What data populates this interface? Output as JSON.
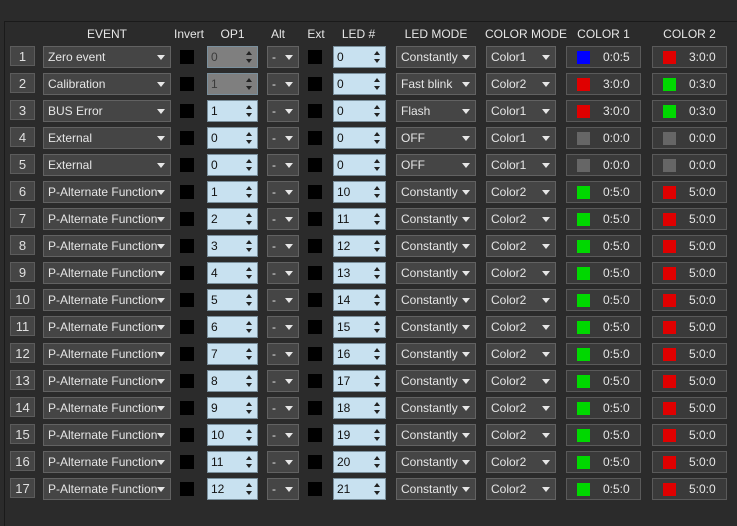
{
  "headers": {
    "event": "EVENT",
    "invert": "Invert",
    "op1": "OP1",
    "alt": "Alt",
    "ext": "Ext",
    "led_num": "LED #",
    "led_mode": "LED MODE",
    "color_mode": "COLOR MODE",
    "color1": "COLOR 1",
    "color2": "COLOR 2"
  },
  "rows": [
    {
      "num": "1",
      "event": "Zero event",
      "op1": "0",
      "op1_disabled": true,
      "alt": "-",
      "led": "0",
      "led_mode": "Constantly",
      "color_mode": "Color1",
      "color1": {
        "color": "#0000ff",
        "value": "0:0:5"
      },
      "color2": {
        "color": "#e00000",
        "value": "3:0:0"
      }
    },
    {
      "num": "2",
      "event": "Calibration",
      "op1": "1",
      "op1_disabled": true,
      "alt": "-",
      "led": "0",
      "led_mode": "Fast blink",
      "color_mode": "Color2",
      "color1": {
        "color": "#e00000",
        "value": "3:0:0"
      },
      "color2": {
        "color": "#00d800",
        "value": "0:3:0"
      }
    },
    {
      "num": "3",
      "event": "BUS Error",
      "op1": "1",
      "op1_disabled": false,
      "alt": "-",
      "led": "0",
      "led_mode": "Flash",
      "color_mode": "Color1",
      "color1": {
        "color": "#e00000",
        "value": "3:0:0"
      },
      "color2": {
        "color": "#00d800",
        "value": "0:3:0"
      }
    },
    {
      "num": "4",
      "event": "External",
      "op1": "0",
      "op1_disabled": false,
      "alt": "-",
      "led": "0",
      "led_mode": "OFF",
      "color_mode": "Color1",
      "color1": {
        "color": "#666666",
        "value": "0:0:0"
      },
      "color2": {
        "color": "#666666",
        "value": "0:0:0"
      }
    },
    {
      "num": "5",
      "event": "External",
      "op1": "0",
      "op1_disabled": false,
      "alt": "-",
      "led": "0",
      "led_mode": "OFF",
      "color_mode": "Color1",
      "color1": {
        "color": "#666666",
        "value": "0:0:0"
      },
      "color2": {
        "color": "#666666",
        "value": "0:0:0"
      }
    },
    {
      "num": "6",
      "event": "P-Alternate Function",
      "op1": "1",
      "op1_disabled": false,
      "alt": "-",
      "led": "10",
      "led_mode": "Constantly",
      "color_mode": "Color2",
      "color1": {
        "color": "#00d800",
        "value": "0:5:0"
      },
      "color2": {
        "color": "#e00000",
        "value": "5:0:0"
      }
    },
    {
      "num": "7",
      "event": "P-Alternate Function",
      "op1": "2",
      "op1_disabled": false,
      "alt": "-",
      "led": "11",
      "led_mode": "Constantly",
      "color_mode": "Color2",
      "color1": {
        "color": "#00d800",
        "value": "0:5:0"
      },
      "color2": {
        "color": "#e00000",
        "value": "5:0:0"
      }
    },
    {
      "num": "8",
      "event": "P-Alternate Function",
      "op1": "3",
      "op1_disabled": false,
      "alt": "-",
      "led": "12",
      "led_mode": "Constantly",
      "color_mode": "Color2",
      "color1": {
        "color": "#00d800",
        "value": "0:5:0"
      },
      "color2": {
        "color": "#e00000",
        "value": "5:0:0"
      }
    },
    {
      "num": "9",
      "event": "P-Alternate Function",
      "op1": "4",
      "op1_disabled": false,
      "alt": "-",
      "led": "13",
      "led_mode": "Constantly",
      "color_mode": "Color2",
      "color1": {
        "color": "#00d800",
        "value": "0:5:0"
      },
      "color2": {
        "color": "#e00000",
        "value": "5:0:0"
      }
    },
    {
      "num": "10",
      "event": "P-Alternate Function",
      "op1": "5",
      "op1_disabled": false,
      "alt": "-",
      "led": "14",
      "led_mode": "Constantly",
      "color_mode": "Color2",
      "color1": {
        "color": "#00d800",
        "value": "0:5:0"
      },
      "color2": {
        "color": "#e00000",
        "value": "5:0:0"
      }
    },
    {
      "num": "11",
      "event": "P-Alternate Function",
      "op1": "6",
      "op1_disabled": false,
      "alt": "-",
      "led": "15",
      "led_mode": "Constantly",
      "color_mode": "Color2",
      "color1": {
        "color": "#00d800",
        "value": "0:5:0"
      },
      "color2": {
        "color": "#e00000",
        "value": "5:0:0"
      }
    },
    {
      "num": "12",
      "event": "P-Alternate Function",
      "op1": "7",
      "op1_disabled": false,
      "alt": "-",
      "led": "16",
      "led_mode": "Constantly",
      "color_mode": "Color2",
      "color1": {
        "color": "#00d800",
        "value": "0:5:0"
      },
      "color2": {
        "color": "#e00000",
        "value": "5:0:0"
      }
    },
    {
      "num": "13",
      "event": "P-Alternate Function",
      "op1": "8",
      "op1_disabled": false,
      "alt": "-",
      "led": "17",
      "led_mode": "Constantly",
      "color_mode": "Color2",
      "color1": {
        "color": "#00d800",
        "value": "0:5:0"
      },
      "color2": {
        "color": "#e00000",
        "value": "5:0:0"
      }
    },
    {
      "num": "14",
      "event": "P-Alternate Function",
      "op1": "9",
      "op1_disabled": false,
      "alt": "-",
      "led": "18",
      "led_mode": "Constantly",
      "color_mode": "Color2",
      "color1": {
        "color": "#00d800",
        "value": "0:5:0"
      },
      "color2": {
        "color": "#e00000",
        "value": "5:0:0"
      }
    },
    {
      "num": "15",
      "event": "P-Alternate Function",
      "op1": "10",
      "op1_disabled": false,
      "alt": "-",
      "led": "19",
      "led_mode": "Constantly",
      "color_mode": "Color2",
      "color1": {
        "color": "#00d800",
        "value": "0:5:0"
      },
      "color2": {
        "color": "#e00000",
        "value": "5:0:0"
      }
    },
    {
      "num": "16",
      "event": "P-Alternate Function",
      "op1": "11",
      "op1_disabled": false,
      "alt": "-",
      "led": "20",
      "led_mode": "Constantly",
      "color_mode": "Color2",
      "color1": {
        "color": "#00d800",
        "value": "0:5:0"
      },
      "color2": {
        "color": "#e00000",
        "value": "5:0:0"
      }
    },
    {
      "num": "17",
      "event": "P-Alternate Function",
      "op1": "12",
      "op1_disabled": false,
      "alt": "-",
      "led": "21",
      "led_mode": "Constantly",
      "color_mode": "Color2",
      "color1": {
        "color": "#00d800",
        "value": "0:5:0"
      },
      "color2": {
        "color": "#e00000",
        "value": "5:0:0"
      }
    }
  ]
}
